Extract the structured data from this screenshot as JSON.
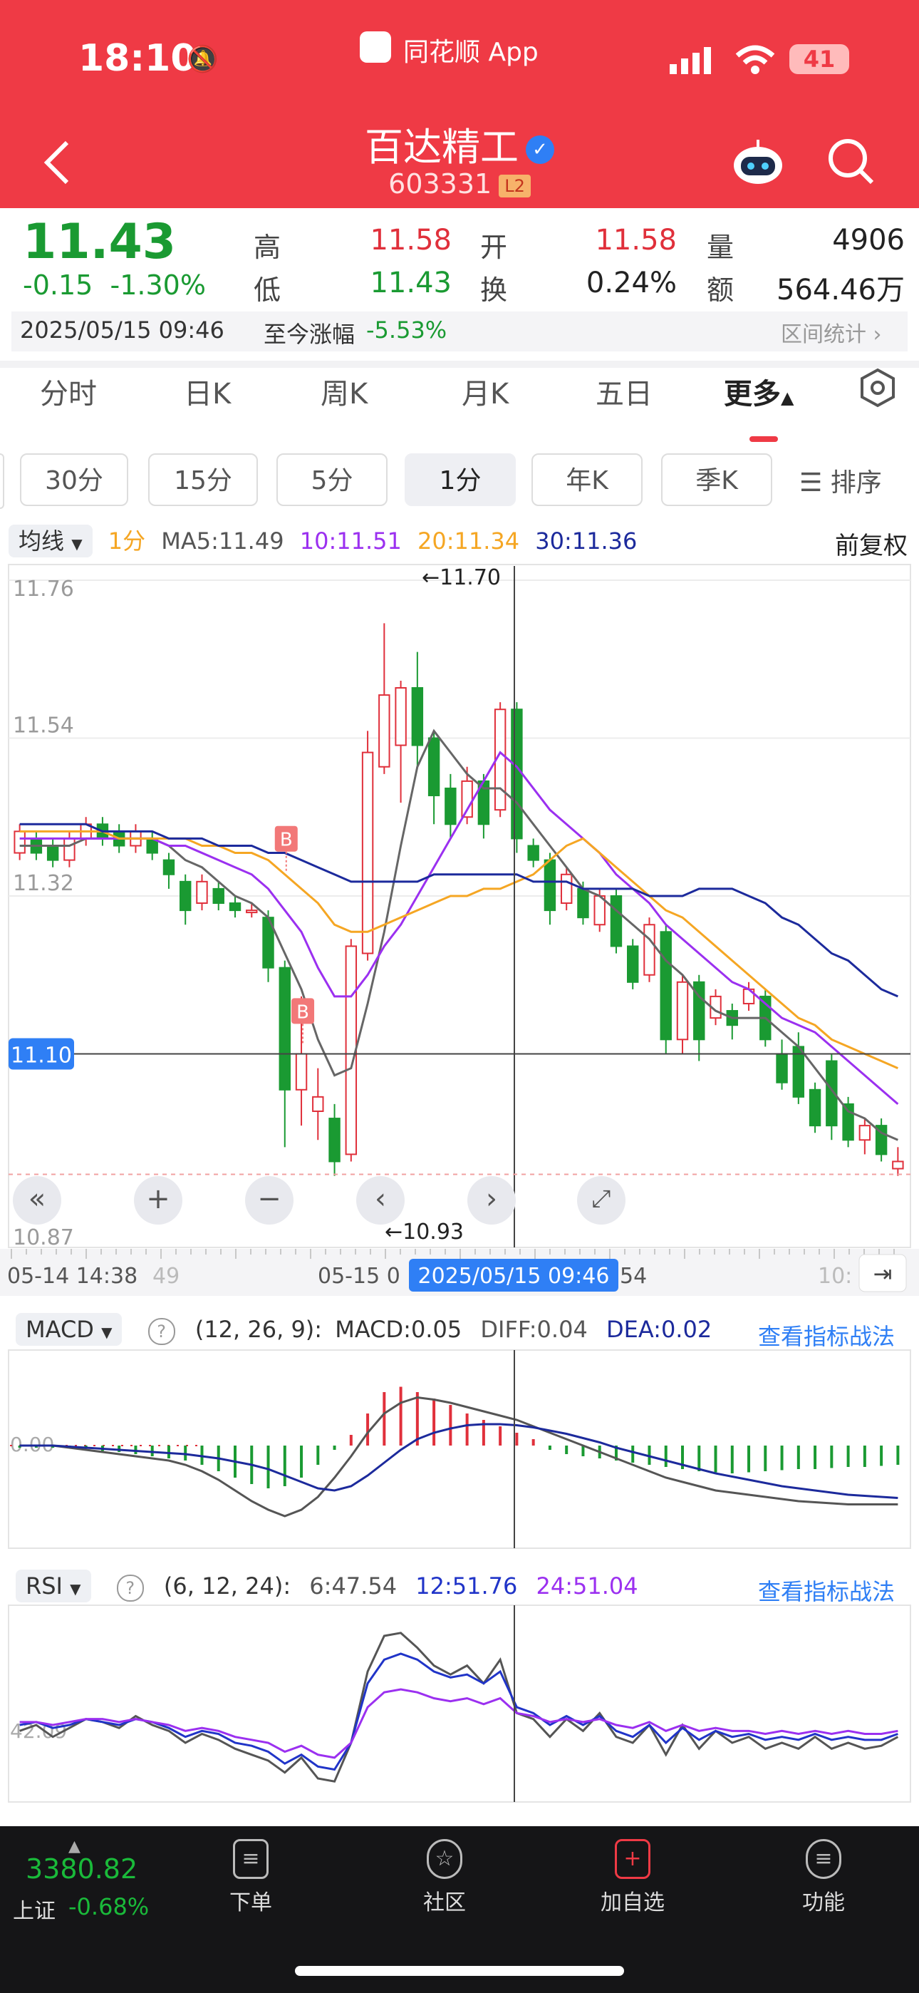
{
  "status": {
    "time": "18:10",
    "app_name": "同花顺 App",
    "battery": "41"
  },
  "header": {
    "title": "百达精工",
    "code": "603331",
    "level": "L2",
    "verified_icon": "check-badge-icon",
    "back_icon": "chevron-left-icon",
    "robot_icon": "robot-icon",
    "search_icon": "search-icon"
  },
  "quote": {
    "price": "11.43",
    "change": "-0.15",
    "change_pct": "-1.30%",
    "high_label": "高",
    "high": "11.58",
    "low_label": "低",
    "low": "11.43",
    "open_label": "开",
    "open": "11.58",
    "turnover_label": "换",
    "turnover": "0.24%",
    "vol_label": "量",
    "vol": "4906",
    "amount_label": "额",
    "amount": "564.46万",
    "datetime": "2025/05/15 09:46",
    "ytd_label": "至今涨幅",
    "ytd": "-5.53%",
    "range_stats": "区间统计"
  },
  "tabs": [
    "分时",
    "日K",
    "周K",
    "月K",
    "五日",
    "更多"
  ],
  "settings_icon": "hexagon-settings-icon",
  "periods": [
    "30分",
    "15分",
    "5分",
    "1分",
    "年K",
    "季K"
  ],
  "period_selected": "1分",
  "sort_label": "排序",
  "ma_bar": {
    "dropdown": "均线",
    "period": "1分",
    "ma5": "MA5:11.49",
    "ma10": "10:11.51",
    "ma20": "20:11.34",
    "ma30": "30:11.36",
    "adjust": "前复权"
  },
  "chart_main": {
    "y_ticks": [
      "11.76",
      "11.54",
      "11.32",
      "10.87"
    ],
    "cross_price": "11.10",
    "high_mark": "←11.70",
    "low_mark": "←10.93",
    "buy_marker": "B"
  },
  "x_axis": {
    "left": "05-14 14:38",
    "mid1": "49",
    "mid2": "05-15 0",
    "cross_time": "2025/05/15 09:46",
    "mid3": "54",
    "right": "10:"
  },
  "controls": {
    "zoom_in": "+",
    "zoom_out": "−"
  },
  "macd": {
    "name": "MACD",
    "params": "(12, 26, 9):",
    "macd": "MACD:0.05",
    "diff": "DIFF:0.04",
    "dea": "DEA:0.02",
    "link": "查看指标战法",
    "zero": "0.00"
  },
  "rsi": {
    "name": "RSI",
    "params": "(6, 12, 24):",
    "r6": "6:47.54",
    "r12": "12:51.76",
    "r24": "24:51.04",
    "link": "查看指标战法",
    "level": "42.09"
  },
  "bottom_nav": {
    "index_value": "3380.82",
    "index_name": "上证",
    "index_pct": "-0.68%",
    "items": [
      {
        "label": "下单",
        "icon": "document-icon"
      },
      {
        "label": "社区",
        "icon": "star-circle-icon"
      },
      {
        "label": "加自选",
        "icon": "plus-square-icon"
      },
      {
        "label": "功能",
        "icon": "menu-circle-icon"
      }
    ]
  },
  "colors": {
    "brand_red": "#ef3a45",
    "up": "#e0303b",
    "down": "#1a9a32",
    "ma5": "#666666",
    "ma10": "#9b30f0",
    "ma20": "#f5a623",
    "ma30": "#1c2a9c",
    "rsi12": "#2034c8",
    "accent_blue": "#2f7ff5"
  },
  "chart_data": {
    "type": "candlestick",
    "title": "",
    "interval": "1分",
    "y_range": [
      10.87,
      11.76
    ],
    "candles": [
      {
        "o": 11.38,
        "c": 11.41,
        "h": 11.42,
        "l": 11.37
      },
      {
        "o": 11.4,
        "c": 11.38,
        "h": 11.41,
        "l": 11.37
      },
      {
        "o": 11.39,
        "c": 11.37,
        "h": 11.4,
        "l": 11.36
      },
      {
        "o": 11.37,
        "c": 11.4,
        "h": 11.41,
        "l": 11.36
      },
      {
        "o": 11.4,
        "c": 11.42,
        "h": 11.43,
        "l": 11.39
      },
      {
        "o": 11.42,
        "c": 11.4,
        "h": 11.43,
        "l": 11.39
      },
      {
        "o": 11.41,
        "c": 11.39,
        "h": 11.42,
        "l": 11.38
      },
      {
        "o": 11.39,
        "c": 11.41,
        "h": 11.42,
        "l": 11.38
      },
      {
        "o": 11.4,
        "c": 11.38,
        "h": 11.41,
        "l": 11.37
      },
      {
        "o": 11.37,
        "c": 11.35,
        "h": 11.38,
        "l": 11.33
      },
      {
        "o": 11.34,
        "c": 11.3,
        "h": 11.35,
        "l": 11.28
      },
      {
        "o": 11.31,
        "c": 11.34,
        "h": 11.35,
        "l": 11.3
      },
      {
        "o": 11.33,
        "c": 11.31,
        "h": 11.34,
        "l": 11.3
      },
      {
        "o": 11.31,
        "c": 11.3,
        "h": 11.32,
        "l": 11.29
      },
      {
        "o": 11.3,
        "c": 11.3,
        "h": 11.31,
        "l": 11.29
      },
      {
        "o": 11.29,
        "c": 11.22,
        "h": 11.3,
        "l": 11.2
      },
      {
        "o": 11.22,
        "c": 11.05,
        "h": 11.23,
        "l": 10.97
      },
      {
        "o": 11.05,
        "c": 11.1,
        "h": 11.18,
        "l": 11.0
      },
      {
        "o": 11.02,
        "c": 11.04,
        "h": 11.08,
        "l": 10.98
      },
      {
        "o": 11.01,
        "c": 10.95,
        "h": 11.03,
        "l": 10.93
      },
      {
        "o": 10.96,
        "c": 11.25,
        "h": 11.26,
        "l": 10.95
      },
      {
        "o": 11.24,
        "c": 11.52,
        "h": 11.55,
        "l": 11.23
      },
      {
        "o": 11.5,
        "c": 11.6,
        "h": 11.7,
        "l": 11.49
      },
      {
        "o": 11.53,
        "c": 11.61,
        "h": 11.62,
        "l": 11.45
      },
      {
        "o": 11.61,
        "c": 11.53,
        "h": 11.66,
        "l": 11.5
      },
      {
        "o": 11.54,
        "c": 11.46,
        "h": 11.55,
        "l": 11.42
      },
      {
        "o": 11.47,
        "c": 11.42,
        "h": 11.49,
        "l": 11.4
      },
      {
        "o": 11.43,
        "c": 11.48,
        "h": 11.5,
        "l": 11.42
      },
      {
        "o": 11.48,
        "c": 11.42,
        "h": 11.49,
        "l": 11.4
      },
      {
        "o": 11.44,
        "c": 11.58,
        "h": 11.59,
        "l": 11.43
      },
      {
        "o": 11.58,
        "c": 11.4,
        "h": 11.59,
        "l": 11.38
      },
      {
        "o": 11.39,
        "c": 11.37,
        "h": 11.4,
        "l": 11.36
      },
      {
        "o": 11.37,
        "c": 11.3,
        "h": 11.38,
        "l": 11.28
      },
      {
        "o": 11.31,
        "c": 11.35,
        "h": 11.36,
        "l": 11.3
      },
      {
        "o": 11.33,
        "c": 11.29,
        "h": 11.34,
        "l": 11.28
      },
      {
        "o": 11.28,
        "c": 11.32,
        "h": 11.33,
        "l": 11.27
      },
      {
        "o": 11.32,
        "c": 11.25,
        "h": 11.33,
        "l": 11.24
      },
      {
        "o": 11.25,
        "c": 11.2,
        "h": 11.26,
        "l": 11.19
      },
      {
        "o": 11.21,
        "c": 11.28,
        "h": 11.29,
        "l": 11.2
      },
      {
        "o": 11.27,
        "c": 11.12,
        "h": 11.28,
        "l": 11.1
      },
      {
        "o": 11.12,
        "c": 11.2,
        "h": 11.21,
        "l": 11.1
      },
      {
        "o": 11.2,
        "c": 11.12,
        "h": 11.21,
        "l": 11.09
      },
      {
        "o": 11.15,
        "c": 11.18,
        "h": 11.19,
        "l": 11.14
      },
      {
        "o": 11.16,
        "c": 11.14,
        "h": 11.17,
        "l": 11.12
      },
      {
        "o": 11.17,
        "c": 11.19,
        "h": 11.2,
        "l": 11.16
      },
      {
        "o": 11.18,
        "c": 11.12,
        "h": 11.19,
        "l": 11.11
      },
      {
        "o": 11.1,
        "c": 11.06,
        "h": 11.12,
        "l": 11.05
      },
      {
        "o": 11.11,
        "c": 11.04,
        "h": 11.13,
        "l": 11.03
      },
      {
        "o": 11.05,
        "c": 11.0,
        "h": 11.06,
        "l": 10.99
      },
      {
        "o": 11.09,
        "c": 11.0,
        "h": 11.1,
        "l": 10.98
      },
      {
        "o": 11.03,
        "c": 10.98,
        "h": 11.04,
        "l": 10.97
      },
      {
        "o": 10.98,
        "c": 11.0,
        "h": 11.01,
        "l": 10.96
      },
      {
        "o": 11.0,
        "c": 10.96,
        "h": 11.01,
        "l": 10.95
      },
      {
        "o": 10.94,
        "c": 10.95,
        "h": 10.97,
        "l": 10.93
      }
    ],
    "ma_lines": [
      {
        "name": "MA5",
        "values": [
          11.39,
          11.39,
          11.39,
          11.39,
          11.4,
          11.4,
          11.4,
          11.4,
          11.4,
          11.39,
          11.37,
          11.36,
          11.34,
          11.32,
          11.31,
          11.29,
          11.24,
          11.19,
          11.12,
          11.07,
          11.08,
          11.17,
          11.27,
          11.39,
          11.5,
          11.55,
          11.52,
          11.49,
          11.47,
          11.47,
          11.45,
          11.42,
          11.39,
          11.36,
          11.33,
          11.32,
          11.3,
          11.28,
          11.26,
          11.23,
          11.21,
          11.18,
          11.16,
          11.15,
          11.15,
          11.15,
          11.13,
          11.11,
          11.08,
          11.05,
          11.02,
          11.01,
          10.99,
          10.98
        ]
      },
      {
        "name": "MA10",
        "values": [
          11.4,
          11.4,
          11.4,
          11.4,
          11.4,
          11.4,
          11.4,
          11.4,
          11.4,
          11.39,
          11.39,
          11.38,
          11.37,
          11.36,
          11.35,
          11.33,
          11.3,
          11.27,
          11.22,
          11.18,
          11.18,
          11.21,
          11.25,
          11.28,
          11.32,
          11.36,
          11.4,
          11.44,
          11.48,
          11.52,
          11.5,
          11.47,
          11.44,
          11.42,
          11.4,
          11.38,
          11.35,
          11.33,
          11.31,
          11.28,
          11.26,
          11.24,
          11.22,
          11.2,
          11.19,
          11.17,
          11.15,
          11.14,
          11.13,
          11.11,
          11.09,
          11.07,
          11.05,
          11.03
        ]
      },
      {
        "name": "MA20",
        "values": [
          11.41,
          11.41,
          11.41,
          11.41,
          11.41,
          11.41,
          11.4,
          11.4,
          11.4,
          11.4,
          11.4,
          11.39,
          11.39,
          11.38,
          11.38,
          11.37,
          11.35,
          11.33,
          11.31,
          11.28,
          11.27,
          11.27,
          11.28,
          11.29,
          11.3,
          11.31,
          11.32,
          11.32,
          11.33,
          11.33,
          11.34,
          11.35,
          11.37,
          11.39,
          11.4,
          11.38,
          11.36,
          11.34,
          11.32,
          11.3,
          11.29,
          11.27,
          11.25,
          11.23,
          11.21,
          11.19,
          11.17,
          11.15,
          11.14,
          11.12,
          11.11,
          11.1,
          11.09,
          11.08
        ]
      },
      {
        "name": "MA30",
        "values": [
          11.42,
          11.42,
          11.42,
          11.42,
          11.42,
          11.41,
          11.41,
          11.41,
          11.41,
          11.4,
          11.4,
          11.4,
          11.39,
          11.39,
          11.39,
          11.38,
          11.38,
          11.37,
          11.36,
          11.35,
          11.34,
          11.34,
          11.34,
          11.34,
          11.34,
          11.35,
          11.35,
          11.35,
          11.35,
          11.35,
          11.35,
          11.34,
          11.34,
          11.34,
          11.33,
          11.33,
          11.33,
          11.33,
          11.32,
          11.32,
          11.32,
          11.33,
          11.33,
          11.33,
          11.32,
          11.31,
          11.29,
          11.28,
          11.26,
          11.24,
          11.23,
          11.21,
          11.19,
          11.18
        ]
      }
    ],
    "macd_hist": [
      -0.002,
      -0.002,
      -0.002,
      -0.002,
      -0.003,
      -0.005,
      -0.006,
      -0.008,
      -0.01,
      -0.012,
      -0.014,
      -0.018,
      -0.024,
      -0.03,
      -0.036,
      -0.04,
      -0.038,
      -0.03,
      -0.018,
      -0.004,
      0.01,
      0.03,
      0.05,
      0.055,
      0.05,
      0.044,
      0.038,
      0.03,
      0.024,
      0.018,
      0.012,
      0.006,
      -0.004,
      -0.008,
      -0.01,
      -0.012,
      -0.014,
      -0.016,
      -0.018,
      -0.02,
      -0.022,
      -0.024,
      -0.025,
      -0.026,
      -0.025,
      -0.024,
      -0.023,
      -0.022,
      -0.022,
      -0.021,
      -0.02,
      -0.02,
      -0.019,
      -0.018
    ],
    "macd_diff": [
      0.0,
      0.0,
      0.0,
      -0.002,
      -0.004,
      -0.006,
      -0.008,
      -0.01,
      -0.012,
      -0.014,
      -0.018,
      -0.024,
      -0.032,
      -0.042,
      -0.052,
      -0.06,
      -0.066,
      -0.06,
      -0.048,
      -0.03,
      -0.01,
      0.012,
      0.03,
      0.04,
      0.045,
      0.043,
      0.04,
      0.036,
      0.032,
      0.028,
      0.024,
      0.018,
      0.012,
      0.006,
      0.0,
      -0.006,
      -0.012,
      -0.018,
      -0.024,
      -0.03,
      -0.034,
      -0.038,
      -0.042,
      -0.044,
      -0.046,
      -0.048,
      -0.05,
      -0.052,
      -0.053,
      -0.054,
      -0.055,
      -0.055,
      -0.055,
      -0.055
    ],
    "macd_dea": [
      0.0,
      0.0,
      0.0,
      -0.001,
      -0.002,
      -0.003,
      -0.004,
      -0.005,
      -0.006,
      -0.007,
      -0.008,
      -0.01,
      -0.012,
      -0.015,
      -0.018,
      -0.022,
      -0.028,
      -0.034,
      -0.04,
      -0.042,
      -0.038,
      -0.028,
      -0.016,
      -0.004,
      0.006,
      0.012,
      0.016,
      0.019,
      0.02,
      0.02,
      0.019,
      0.017,
      0.014,
      0.011,
      0.007,
      0.003,
      -0.002,
      -0.006,
      -0.01,
      -0.014,
      -0.018,
      -0.022,
      -0.026,
      -0.029,
      -0.032,
      -0.035,
      -0.038,
      -0.04,
      -0.042,
      -0.044,
      -0.046,
      -0.047,
      -0.048,
      -0.049
    ],
    "rsi_lines": [
      {
        "name": "RSI6",
        "values": [
          42,
          44,
          40,
          43,
          46,
          45,
          43,
          47,
          44,
          42,
          38,
          41,
          39,
          36,
          34,
          32,
          28,
          33,
          26,
          25,
          38,
          62,
          74,
          75,
          70,
          64,
          61,
          64,
          58,
          66,
          48,
          46,
          40,
          46,
          42,
          48,
          40,
          38,
          44,
          34,
          44,
          36,
          42,
          38,
          40,
          36,
          38,
          36,
          40,
          36,
          38,
          36,
          37,
          40
        ]
      },
      {
        "name": "RSI12",
        "values": [
          44,
          45,
          43,
          44,
          46,
          45,
          44,
          46,
          45,
          43,
          40,
          42,
          41,
          38,
          37,
          35,
          31,
          34,
          30,
          29,
          38,
          58,
          66,
          68,
          66,
          62,
          60,
          61,
          58,
          62,
          50,
          48,
          44,
          47,
          44,
          47,
          42,
          40,
          44,
          38,
          43,
          39,
          42,
          40,
          41,
          39,
          40,
          39,
          41,
          39,
          40,
          39,
          39,
          41
        ]
      },
      {
        "name": "RSI24",
        "values": [
          45,
          45,
          44,
          45,
          46,
          46,
          45,
          46,
          45,
          44,
          42,
          43,
          42,
          40,
          39,
          38,
          35,
          37,
          34,
          33,
          38,
          50,
          55,
          56,
          55,
          53,
          52,
          53,
          51,
          53,
          48,
          47,
          45,
          46,
          45,
          46,
          44,
          43,
          45,
          42,
          44,
          42,
          43,
          42,
          42,
          41,
          42,
          41,
          42,
          41,
          42,
          41,
          41,
          42
        ]
      }
    ]
  }
}
